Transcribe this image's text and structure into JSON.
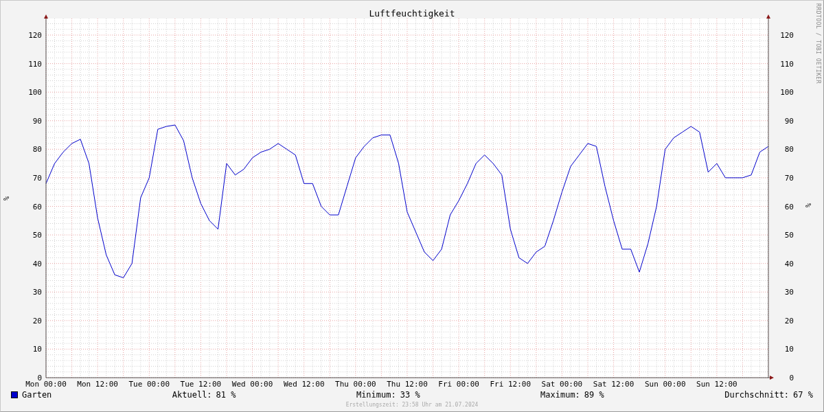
{
  "graph": {
    "credit": "RRDTOOL / TOBI OETIKER",
    "chart_data": {
      "type": "line",
      "title": "Luftfeuchtigkeit",
      "ylabel": "%",
      "ylim": [
        0,
        125
      ],
      "grid": true,
      "yticks": [
        0,
        10,
        20,
        30,
        40,
        50,
        60,
        70,
        80,
        90,
        100,
        110,
        120
      ],
      "categories": [
        "Mon 00:00",
        null,
        null,
        null,
        null,
        null,
        "Mon 12:00",
        null,
        null,
        null,
        null,
        null,
        "Tue 00:00",
        null,
        null,
        null,
        null,
        null,
        "Tue 12:00",
        null,
        null,
        null,
        null,
        null,
        "Wed 00:00",
        null,
        null,
        null,
        null,
        null,
        "Wed 12:00",
        null,
        null,
        null,
        null,
        null,
        "Thu 00:00",
        null,
        null,
        null,
        null,
        null,
        "Thu 12:00",
        null,
        null,
        null,
        null,
        null,
        "Fri 00:00",
        null,
        null,
        null,
        null,
        null,
        "Fri 12:00",
        null,
        null,
        null,
        null,
        null,
        "Sat 00:00",
        null,
        null,
        null,
        null,
        null,
        "Sat 12:00",
        null,
        null,
        null,
        null,
        null,
        "Sun 00:00",
        null,
        null,
        null,
        null,
        null,
        "Sun 12:00",
        null,
        null,
        null,
        null,
        null,
        null
      ],
      "series": [
        {
          "name": "Garten",
          "color": "#0000cc",
          "values": [
            68,
            75,
            79,
            82,
            83.5,
            75,
            56,
            43,
            36,
            35,
            40,
            63,
            70,
            87,
            88,
            88.5,
            83,
            70,
            61,
            55,
            52,
            75,
            71,
            73,
            77,
            79,
            80,
            82,
            80,
            78,
            68,
            68,
            60,
            57,
            57,
            67,
            77,
            81,
            84,
            85,
            85,
            75,
            58,
            51,
            44,
            41,
            45,
            57,
            62,
            68,
            75,
            78,
            75,
            71,
            52,
            42,
            40,
            44,
            46,
            55,
            65,
            74,
            78,
            82,
            81,
            67,
            55,
            45,
            45,
            37,
            47,
            60,
            80,
            84,
            86,
            88,
            86,
            72,
            75,
            70,
            70,
            70,
            71,
            79,
            81
          ]
        }
      ]
    },
    "right_axis": {
      "label": "%",
      "ticks": [
        "120",
        "110",
        "100",
        "90",
        "80",
        "70",
        "60",
        "50",
        "40",
        "30",
        "20",
        "10",
        "0"
      ]
    }
  },
  "legend": {
    "stats": [
      {
        "label": "Aktuell:",
        "value": "81 %"
      },
      {
        "label": "Minimum:",
        "value": "33 %"
      },
      {
        "label": "Maximum:",
        "value": "89 %"
      },
      {
        "label": "Durchschnitt:",
        "value": "67 %"
      }
    ]
  },
  "footer": "Erstellungszeit: 23:58 Uhr am 21.07.2024"
}
